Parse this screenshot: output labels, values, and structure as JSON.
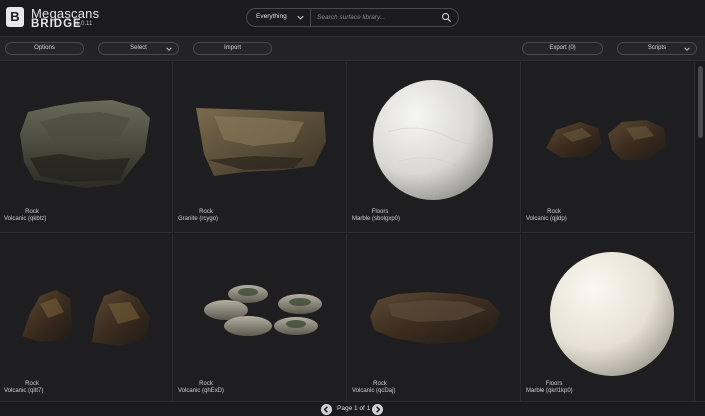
{
  "brand": {
    "logo_letter": "B",
    "name": "Megascans",
    "product": "BRIDGE",
    "version": "1.0.11"
  },
  "search": {
    "filter_value": "Everything",
    "placeholder": "Search surface library..."
  },
  "toolbar": {
    "options": "Options",
    "select": "Select",
    "import": "Import",
    "export": "Export (0)",
    "scripts": "Scripts"
  },
  "assets": [
    {
      "category": "Rock",
      "name": "Volcanic (qkbtz)"
    },
    {
      "category": "Rock",
      "name": "Granite (rcygo)"
    },
    {
      "category": "Floors",
      "name": "Marble (sbolgxp0)"
    },
    {
      "category": "Rock",
      "name": "Volcanic (qjldp)"
    },
    {
      "category": "Rock",
      "name": "Volcanic (qitt7)"
    },
    {
      "category": "Rock",
      "name": "Volcanic (qhExD)"
    },
    {
      "category": "Rock",
      "name": "Volcanic (qcDaj)"
    },
    {
      "category": "Floors",
      "name": "Marble (qkrl1kp0)"
    }
  ],
  "pagination": {
    "label": "Page 1 of 1"
  },
  "icons": {
    "logo": "bridge-logo-icon",
    "chevron": "chevron-down-icon",
    "search": "search-icon",
    "prev": "prev-page-icon",
    "next": "next-page-icon"
  }
}
